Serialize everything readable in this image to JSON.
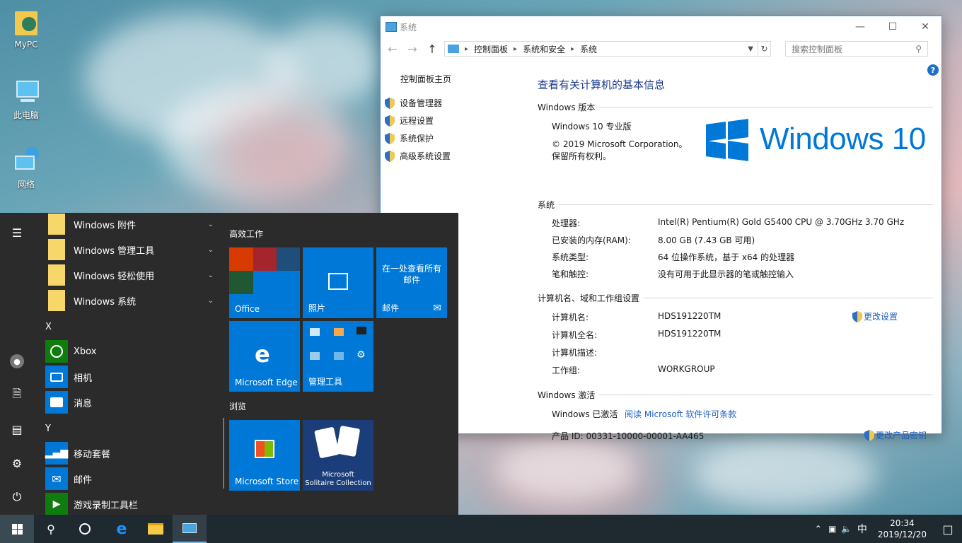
{
  "desktop": {
    "icons": [
      {
        "label": "MyPC"
      },
      {
        "label": "此电脑"
      },
      {
        "label": "网络"
      }
    ]
  },
  "window": {
    "title": "系统",
    "breadcrumb": [
      "控制面板",
      "系统和安全",
      "系统"
    ],
    "search_placeholder": "搜索控制面板",
    "left": {
      "home": "控制面板主页",
      "links": [
        "设备管理器",
        "远程设置",
        "系统保护",
        "高级系统设置"
      ]
    },
    "heading": "查看有关计算机的基本信息",
    "edition": {
      "section": "Windows 版本",
      "name": "Windows 10 专业版",
      "copyright": "© 2019 Microsoft Corporation。",
      "rights": "保留所有权利。",
      "logo_text": "Windows 10"
    },
    "system": {
      "section": "系统",
      "rows": [
        {
          "label": "处理器:",
          "value": "Intel(R) Pentium(R) Gold G5400 CPU @ 3.70GHz   3.70 GHz"
        },
        {
          "label": "已安装的内存(RAM):",
          "value": "8.00 GB (7.43 GB 可用)"
        },
        {
          "label": "系统类型:",
          "value": "64 位操作系统，基于 x64 的处理器"
        },
        {
          "label": "笔和触控:",
          "value": "没有可用于此显示器的笔或触控输入"
        }
      ]
    },
    "computer": {
      "section": "计算机名、域和工作组设置",
      "change_link": "更改设置",
      "rows": [
        {
          "label": "计算机名:",
          "value": "HDS191220TM"
        },
        {
          "label": "计算机全名:",
          "value": "HDS191220TM"
        },
        {
          "label": "计算机描述:",
          "value": ""
        },
        {
          "label": "工作组:",
          "value": "WORKGROUP"
        }
      ]
    },
    "activation": {
      "section": "Windows 激活",
      "status": "Windows 已激活",
      "license_link": "阅读 Microsoft 软件许可条款",
      "product_id": "产品 ID: 00331-10000-00001-AA465",
      "change_key": "更改产品密钥"
    }
  },
  "start": {
    "apps": [
      {
        "label": "Windows 附件",
        "folder": true
      },
      {
        "label": "Windows 管理工具",
        "folder": true
      },
      {
        "label": "Windows 轻松使用",
        "folder": true
      },
      {
        "label": "Windows 系统",
        "folder": true
      },
      {
        "label": "Xbox"
      },
      {
        "label": "相机"
      },
      {
        "label": "消息"
      },
      {
        "label": "移动套餐"
      },
      {
        "label": "邮件"
      },
      {
        "label": "游戏录制工具栏"
      }
    ],
    "letters": [
      "X",
      "Y"
    ],
    "groups": [
      "高效工作",
      "浏览"
    ],
    "tiles": {
      "office": "Office",
      "photos": "照片",
      "mail_text": "在一处查看所有邮件",
      "mail": "邮件",
      "edge": "Microsoft Edge",
      "admin": "管理工具",
      "store": "Microsoft Store",
      "solitaire_line1": "Microsoft",
      "solitaire_line2": "Solitaire Collection"
    }
  },
  "taskbar": {
    "ime": "中",
    "time": "20:34",
    "date": "2019/12/20"
  }
}
